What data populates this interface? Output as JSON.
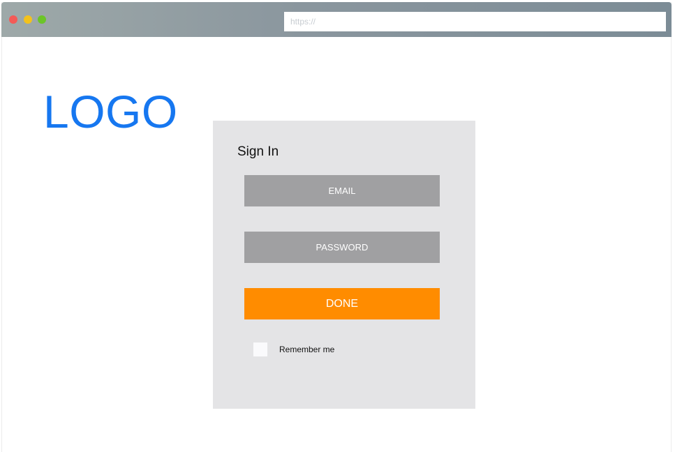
{
  "browser": {
    "url_placeholder": "https://"
  },
  "brand": {
    "logo_text": "LOGO",
    "logo_color": "#1677f0"
  },
  "signin": {
    "title": "Sign In",
    "email_label": "EMAIL",
    "password_label": "PASSWORD",
    "submit_label": "DONE",
    "submit_color": "#ff8c00",
    "remember_label": "Remember me",
    "remember_checked": false
  }
}
